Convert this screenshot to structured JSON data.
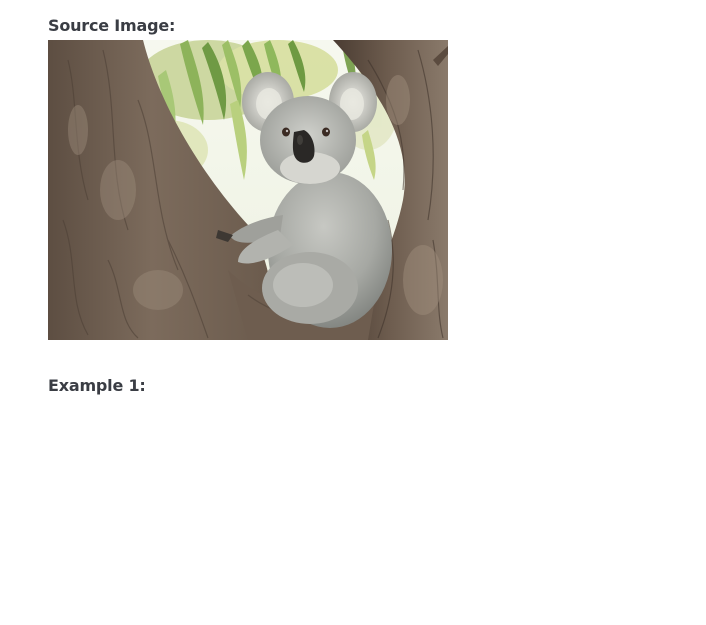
{
  "source_section": {
    "label": "Source Image:",
    "image": {
      "subject": "koala-photo"
    }
  },
  "example_section": {
    "label": "Example 1:"
  }
}
